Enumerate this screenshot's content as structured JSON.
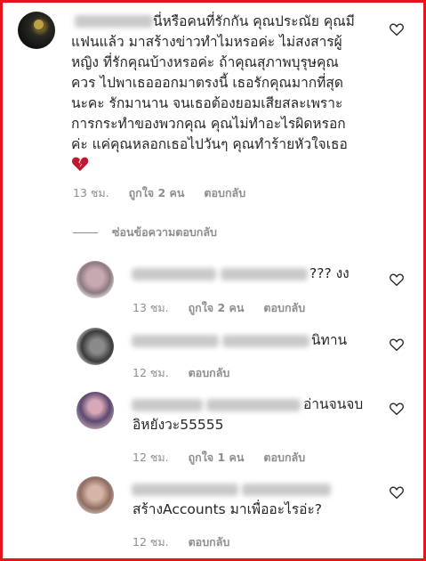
{
  "main_comment": {
    "lines": [
      "นี่หรือคนที่รักกัน คุณประณัย คุณมี",
      "แฟนแล้ว มาสร้างข่าวทำไมหรอค่ะ ไม่สงสารผู้",
      "หญิง ที่รักคุณบ้างหรอค่ะ ถ้าคุณสุภาพบุรุษคุณ",
      "ควร ไปพาเธอออกมาตรงนี้ เธอรักคุณมากที่สุด",
      "นะคะ รักมานาน จนเธอต้องยอมเสียสละเพราะ",
      "การกระทำของพวกคุณ คุณไม่ทำอะไรผิดหรอก",
      "ค่ะ แค่คุณหลอกเธอไปวันๆ คุณทำร้ายหัวใจเธอ"
    ],
    "emoji": "broken-heart",
    "time": "13 ชม.",
    "likes": "ถูกใจ 2 คน",
    "reply": "ตอบกลับ"
  },
  "hide_replies_label": "ซ่อนข้อความตอบกลับ",
  "replies": [
    {
      "text": "??? งง",
      "time": "13 ชม.",
      "likes": "ถูกใจ 2 คน",
      "reply": "ตอบกลับ"
    },
    {
      "text": "นิทาน",
      "time": "12 ชม.",
      "likes": "",
      "reply": "ตอบกลับ"
    },
    {
      "line1": "อ่านจนจบ",
      "line2": "อิหยังวะ55555",
      "time": "12 ชม.",
      "likes": "ถูกใจ 1 คน",
      "reply": "ตอบกลับ"
    },
    {
      "text": "สร้างAccounts มาเพื่ออะไรอ่ะ?",
      "time": "12 ชม.",
      "likes": "",
      "reply": "ตอบกลับ"
    }
  ],
  "icons": {
    "like": "heart-outline-icon",
    "emoji": "broken-heart-icon"
  },
  "colors": {
    "border": "#e8141c",
    "meta": "#8e8e8e",
    "text": "#262626"
  }
}
